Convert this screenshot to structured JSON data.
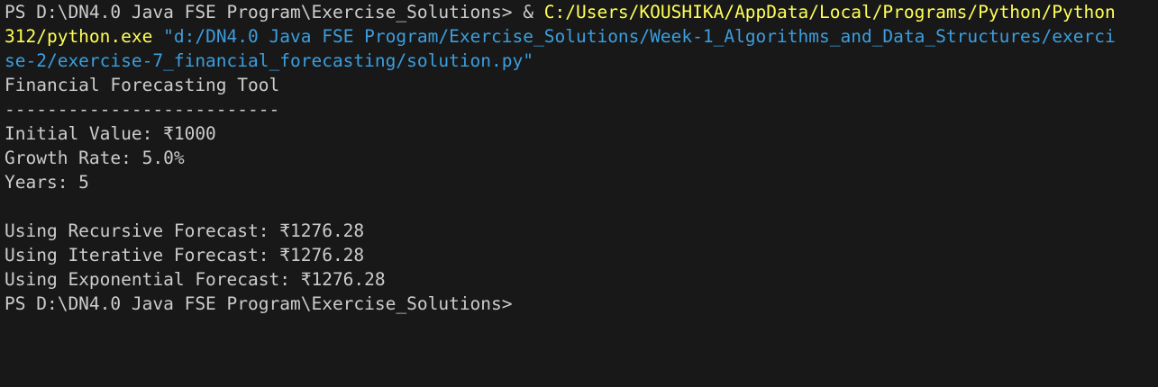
{
  "terminal": {
    "prompt": "PS D:\\DN4.0 Java FSE Program\\Exercise_Solutions> ",
    "amp": "& ",
    "command_line1": "C:/Users/KOUSHIKA/AppData/Local/Programs/Python/Python",
    "command_line2": "312/python.exe",
    "arg_line2": " \"d:/DN4.0 Java FSE Program/Exercise_Solutions/Week-1_Algorithms_and_Data_Structures/exerci",
    "arg_line3": "se-2/exercise-7_financial_forecasting/solution.py\"",
    "output": [
      "Financial Forecasting Tool",
      "--------------------------",
      "Initial Value: ₹1000",
      "Growth Rate: 5.0%",
      "Years: 5",
      "",
      "Using Recursive Forecast: ₹1276.28",
      "Using Iterative Forecast: ₹1276.28",
      "Using Exponential Forecast: ₹1276.28"
    ],
    "final_prompt": "PS D:\\DN4.0 Java FSE Program\\Exercise_Solutions>"
  },
  "colors": {
    "background": "#181818",
    "text": "#cccccc",
    "command": "#ffff55",
    "string_arg": "#3b9ede"
  }
}
